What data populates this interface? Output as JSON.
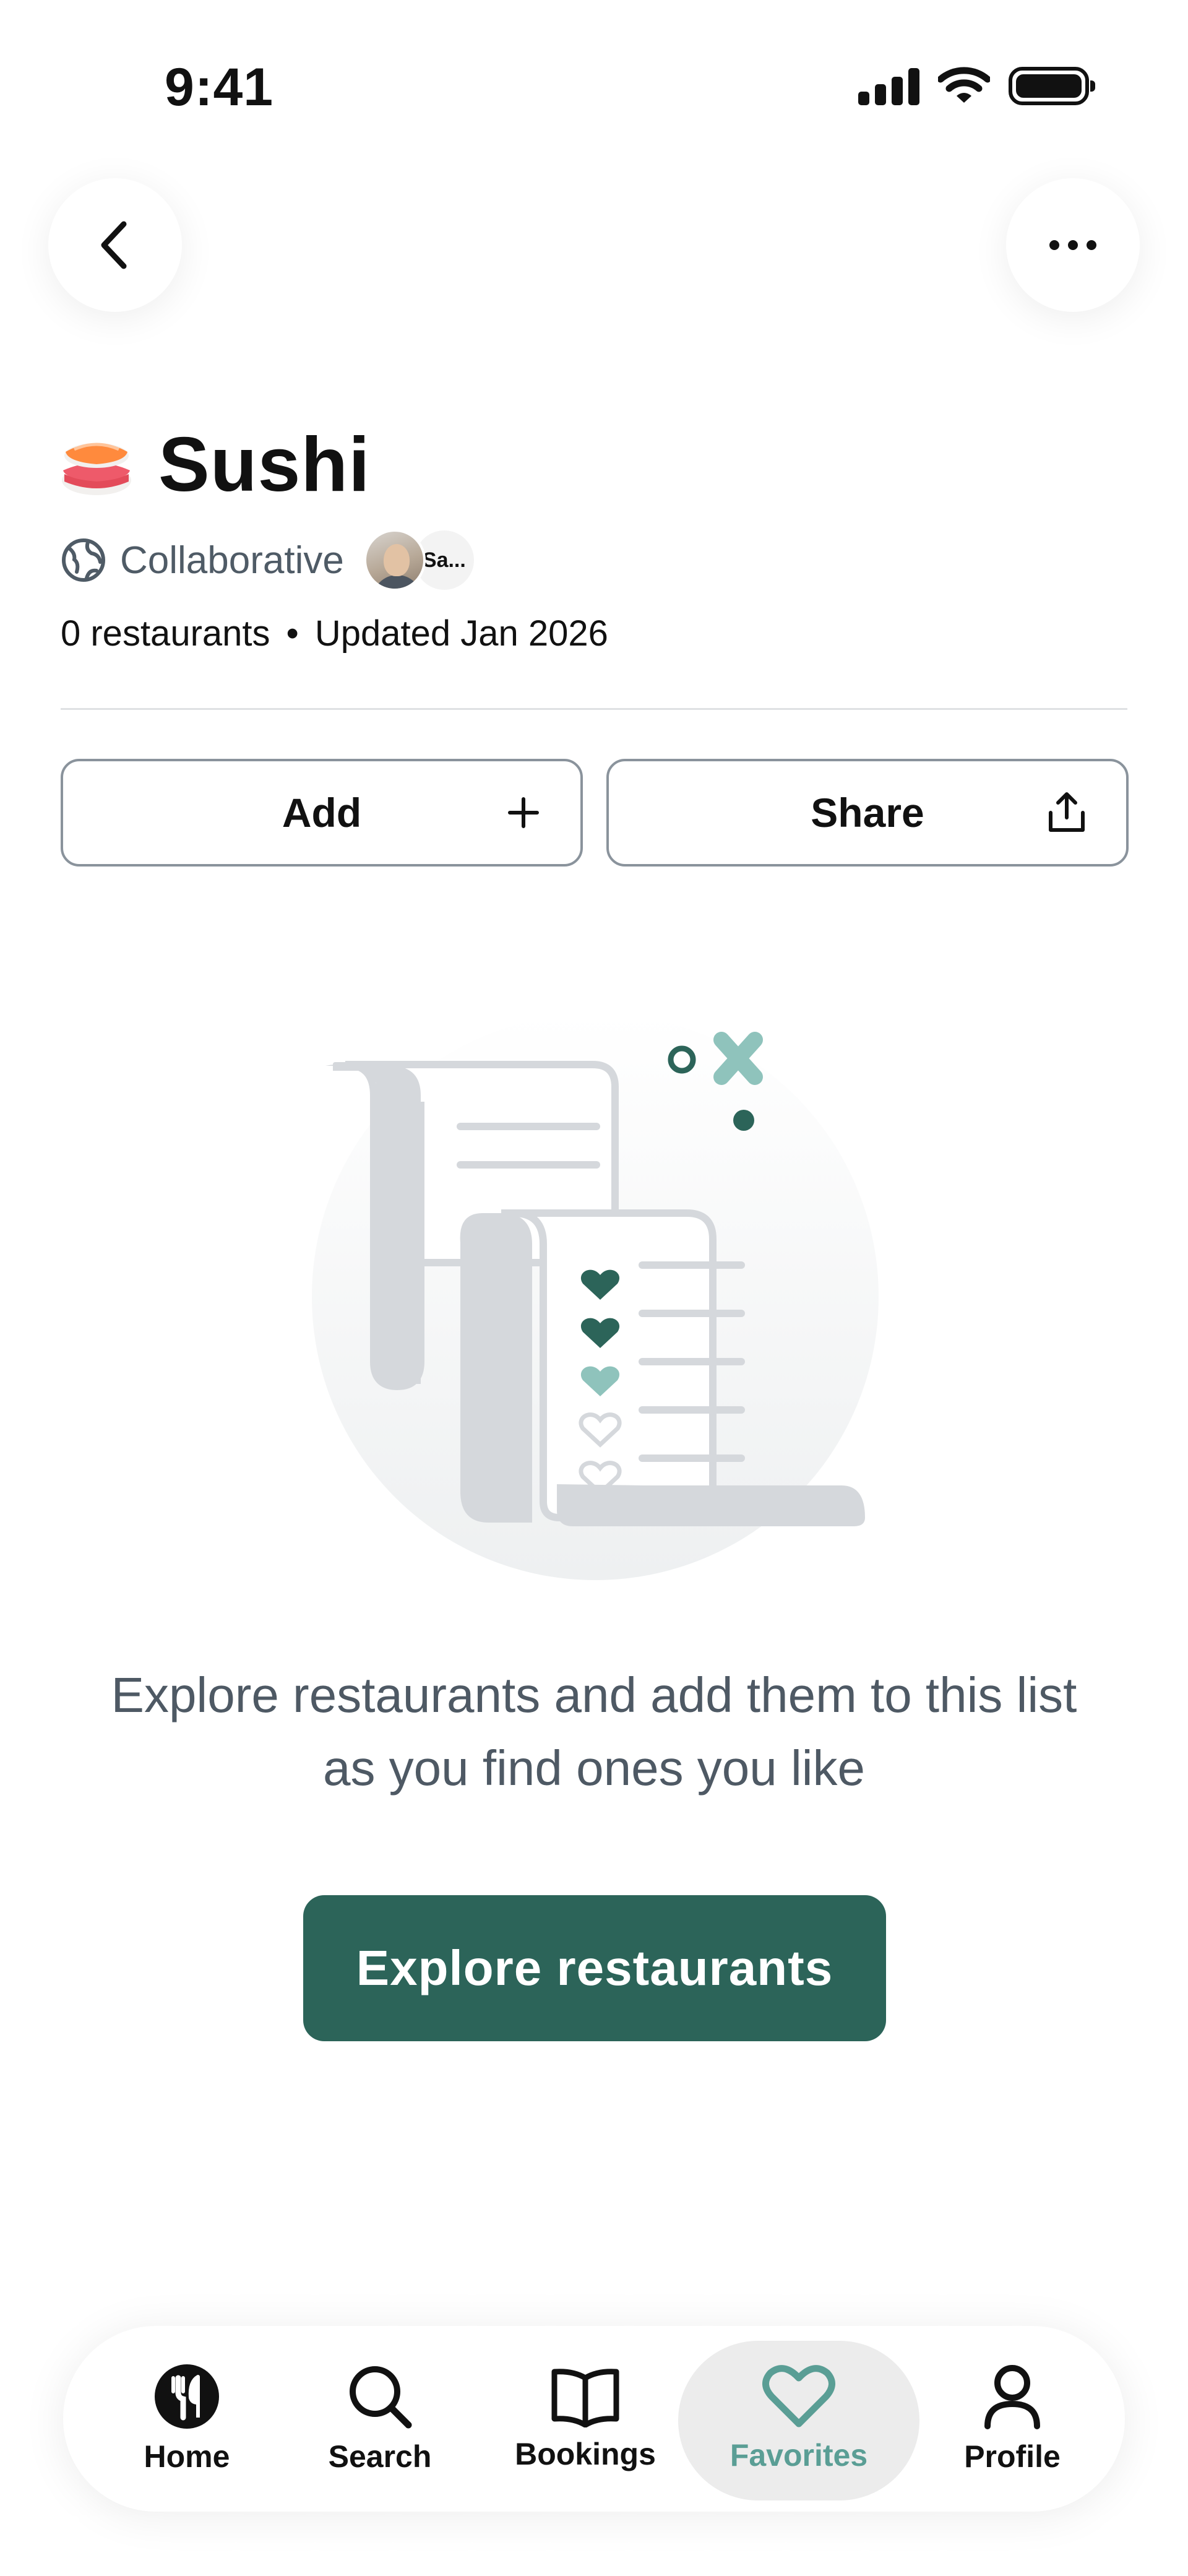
{
  "status_bar": {
    "time": "9:41"
  },
  "header": {
    "title": "Sushi",
    "collaboration": "Collaborative",
    "collaborator_initials": "Sa...",
    "restaurant_count": "0 restaurants",
    "separator": "•",
    "updated": "Updated Jan 2026"
  },
  "actions": {
    "add_label": "Add",
    "share_label": "Share"
  },
  "empty_state": {
    "line1": "Explore restaurants and add them to this list",
    "line2": "as you find ones you like",
    "cta_label": "Explore restaurants"
  },
  "nav": {
    "items": [
      {
        "label": "Home",
        "icon": "fork-knife-icon"
      },
      {
        "label": "Search",
        "icon": "search-icon"
      },
      {
        "label": "Bookings",
        "icon": "book-icon"
      },
      {
        "label": "Favorites",
        "icon": "heart-icon",
        "active": true
      },
      {
        "label": "Profile",
        "icon": "person-icon"
      }
    ]
  },
  "colors": {
    "brand_primary": "#2c6459",
    "active_tab": "#5a9e95",
    "secondary_text": "#4e5964"
  }
}
